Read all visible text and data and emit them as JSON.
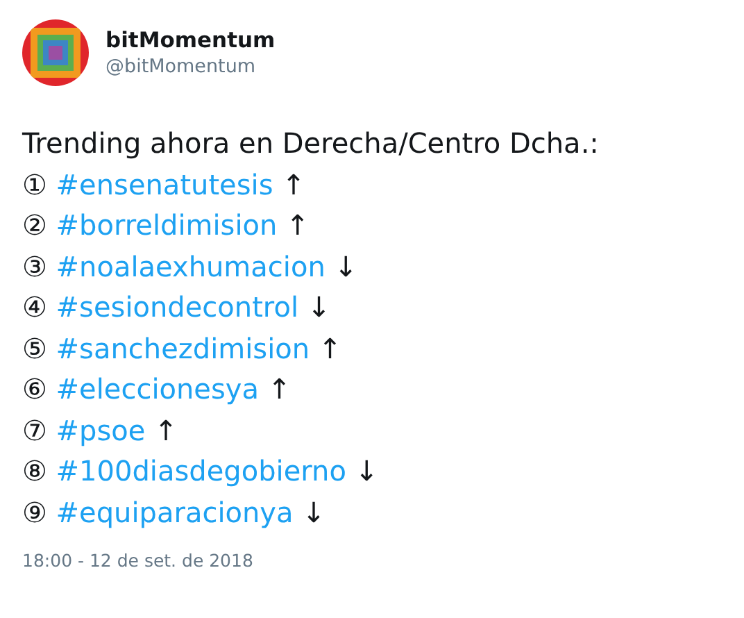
{
  "author": {
    "name": "bitMomentum",
    "handle": "@bitMomentum"
  },
  "heading": "Trending ahora en Derecha/Centro Dcha.:",
  "trends": [
    {
      "number": "①",
      "hashtag": "#ensenatutesis",
      "arrow": "↑"
    },
    {
      "number": "②",
      "hashtag": "#borreldimision",
      "arrow": "↑"
    },
    {
      "number": "③",
      "hashtag": "#noalaexhumacion",
      "arrow": "↓"
    },
    {
      "number": "④",
      "hashtag": "#sesiondecontrol",
      "arrow": "↓"
    },
    {
      "number": "⑤",
      "hashtag": "#sanchezdimision",
      "arrow": "↑"
    },
    {
      "number": "⑥",
      "hashtag": "#eleccionesya",
      "arrow": "↑"
    },
    {
      "number": "⑦",
      "hashtag": "#psoe",
      "arrow": "↑"
    },
    {
      "number": "⑧",
      "hashtag": "#100diasdegobierno",
      "arrow": "↓"
    },
    {
      "number": "⑨",
      "hashtag": "#equiparacionya",
      "arrow": "↓"
    }
  ],
  "timestamp": "18:00 - 12 de set. de 2018"
}
